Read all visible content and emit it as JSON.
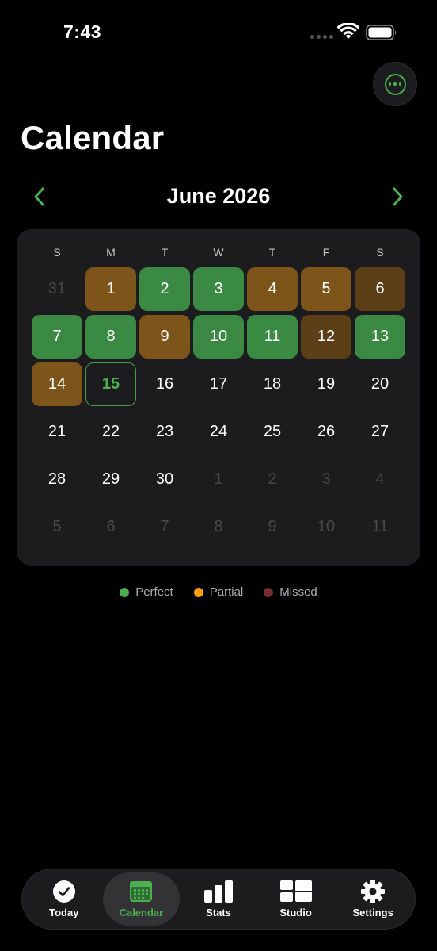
{
  "status_bar": {
    "time": "7:43"
  },
  "header": {
    "title": "Calendar",
    "more_icon": "ellipsis-circle-icon"
  },
  "month_nav": {
    "label": "June 2026",
    "prev_icon": "chevron-left-icon",
    "next_icon": "chevron-right-icon"
  },
  "colors": {
    "accent": "#4caf50",
    "perfect": "#3b8a43",
    "partial": "#7d5419",
    "missed": "#7a2a2a",
    "partial_legend": "#ff9f0a"
  },
  "weekdays": [
    "S",
    "M",
    "T",
    "W",
    "T",
    "F",
    "S"
  ],
  "days": [
    {
      "label": "31",
      "status": "outside"
    },
    {
      "label": "1",
      "status": "partial"
    },
    {
      "label": "2",
      "status": "perfect"
    },
    {
      "label": "3",
      "status": "perfect"
    },
    {
      "label": "4",
      "status": "partial"
    },
    {
      "label": "5",
      "status": "partial"
    },
    {
      "label": "6",
      "status": "partial-dark"
    },
    {
      "label": "7",
      "status": "perfect"
    },
    {
      "label": "8",
      "status": "perfect"
    },
    {
      "label": "9",
      "status": "partial"
    },
    {
      "label": "10",
      "status": "perfect"
    },
    {
      "label": "11",
      "status": "perfect"
    },
    {
      "label": "12",
      "status": "partial-dark"
    },
    {
      "label": "13",
      "status": "perfect"
    },
    {
      "label": "14",
      "status": "partial"
    },
    {
      "label": "15",
      "status": "today"
    },
    {
      "label": "16",
      "status": "none"
    },
    {
      "label": "17",
      "status": "none"
    },
    {
      "label": "18",
      "status": "none"
    },
    {
      "label": "19",
      "status": "none"
    },
    {
      "label": "20",
      "status": "none"
    },
    {
      "label": "21",
      "status": "none"
    },
    {
      "label": "22",
      "status": "none"
    },
    {
      "label": "23",
      "status": "none"
    },
    {
      "label": "24",
      "status": "none"
    },
    {
      "label": "25",
      "status": "none"
    },
    {
      "label": "26",
      "status": "none"
    },
    {
      "label": "27",
      "status": "none"
    },
    {
      "label": "28",
      "status": "none"
    },
    {
      "label": "29",
      "status": "none"
    },
    {
      "label": "30",
      "status": "none"
    },
    {
      "label": "1",
      "status": "outside"
    },
    {
      "label": "2",
      "status": "outside"
    },
    {
      "label": "3",
      "status": "outside"
    },
    {
      "label": "4",
      "status": "outside"
    },
    {
      "label": "5",
      "status": "outside"
    },
    {
      "label": "6",
      "status": "outside"
    },
    {
      "label": "7",
      "status": "outside"
    },
    {
      "label": "8",
      "status": "outside"
    },
    {
      "label": "9",
      "status": "outside"
    },
    {
      "label": "10",
      "status": "outside"
    },
    {
      "label": "11",
      "status": "outside"
    }
  ],
  "legend": [
    {
      "label": "Perfect",
      "color": "#4caf50"
    },
    {
      "label": "Partial",
      "color": "#ff9f0a"
    },
    {
      "label": "Missed",
      "color": "#7a2a2a"
    }
  ],
  "tabs": [
    {
      "label": "Today",
      "icon": "checkmark-circle-icon",
      "active": false
    },
    {
      "label": "Calendar",
      "icon": "calendar-icon",
      "active": true
    },
    {
      "label": "Stats",
      "icon": "bar-chart-icon",
      "active": false
    },
    {
      "label": "Studio",
      "icon": "layout-blocks-icon",
      "active": false
    },
    {
      "label": "Settings",
      "icon": "gear-icon",
      "active": false
    }
  ]
}
